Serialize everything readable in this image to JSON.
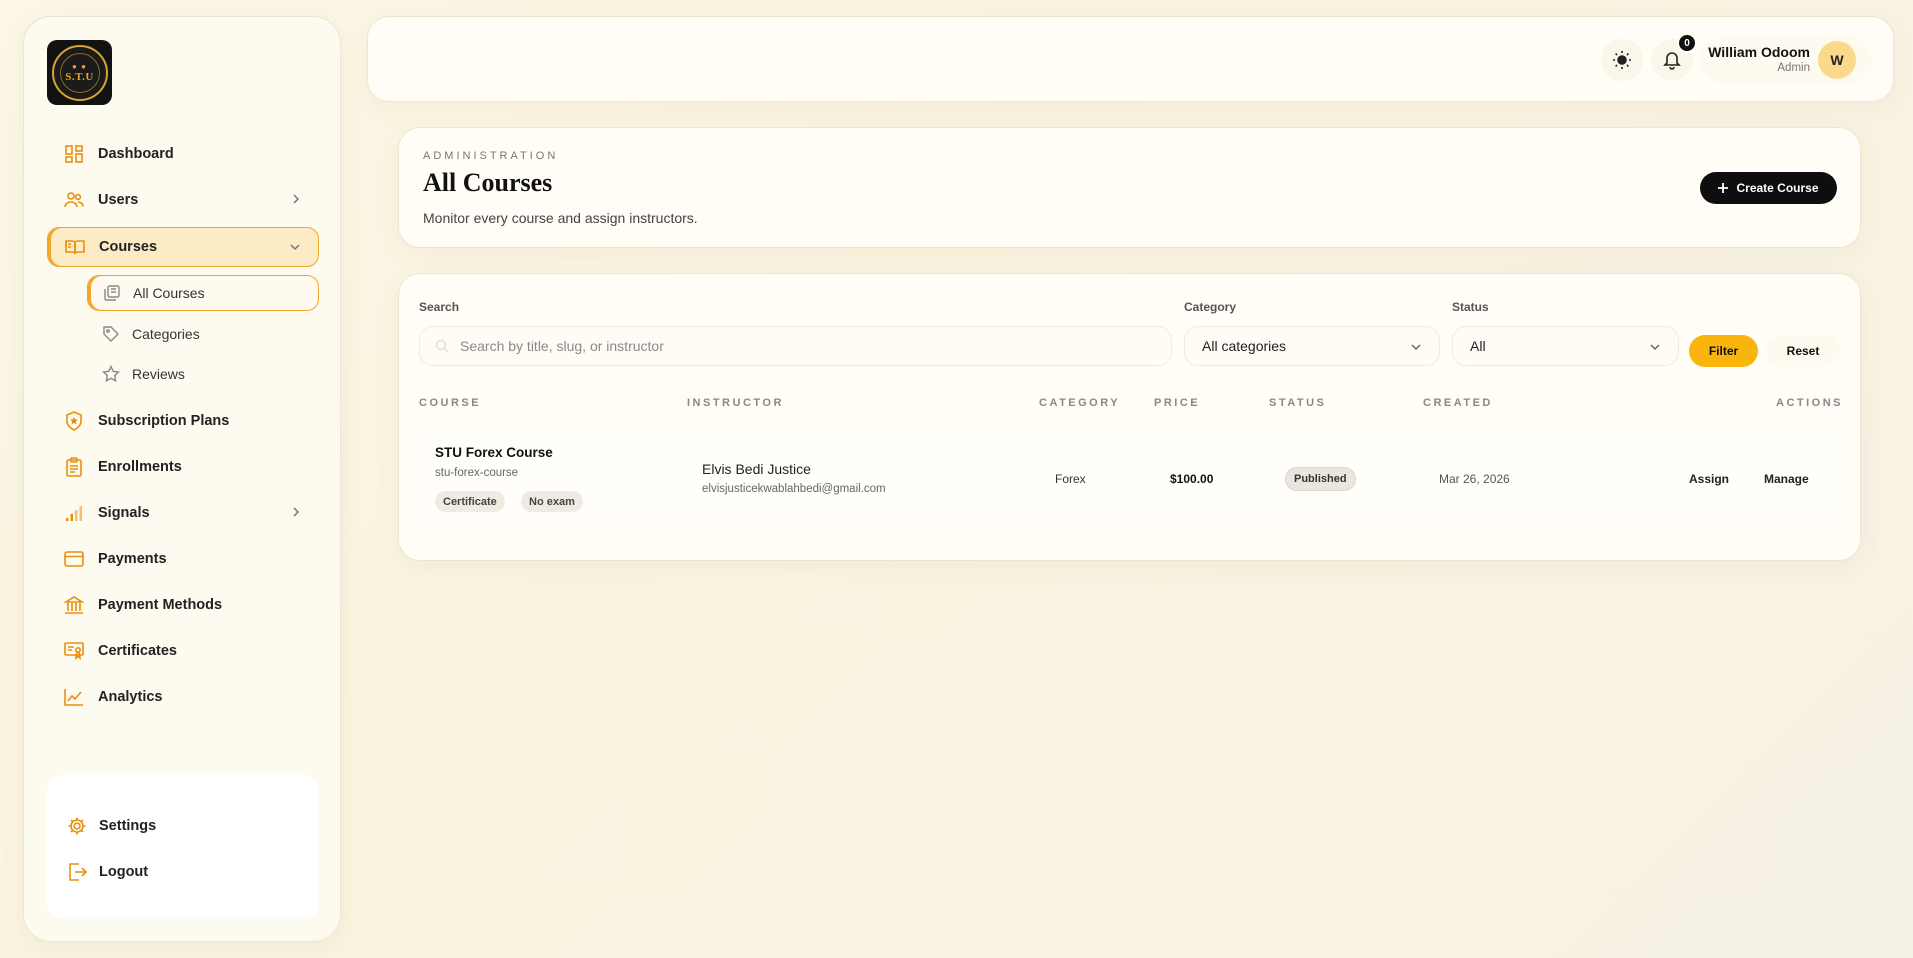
{
  "brand": {
    "logo_text": "S.T.U",
    "logo_ring_text": "SERENDIPITY TRADING UNIVERSITY"
  },
  "sidebar": {
    "items": [
      {
        "label": "Dashboard",
        "icon": "dashboard-icon"
      },
      {
        "label": "Users",
        "icon": "users-icon"
      },
      {
        "label": "Courses",
        "icon": "book-icon"
      },
      {
        "label": "Subscription Plans",
        "icon": "shield-star-icon"
      },
      {
        "label": "Enrollments",
        "icon": "clipboard-icon"
      },
      {
        "label": "Signals",
        "icon": "signal-bars-icon"
      },
      {
        "label": "Payments",
        "icon": "credit-card-icon"
      },
      {
        "label": "Payment Methods",
        "icon": "bank-icon"
      },
      {
        "label": "Certificates",
        "icon": "certificate-icon"
      },
      {
        "label": "Analytics",
        "icon": "chart-line-icon"
      }
    ],
    "sub_items": [
      {
        "label": "All Courses",
        "icon": "copy-icon"
      },
      {
        "label": "Categories",
        "icon": "tag-icon"
      },
      {
        "label": "Reviews",
        "icon": "star-icon"
      }
    ],
    "bottom": [
      {
        "label": "Settings",
        "icon": "gear-icon"
      },
      {
        "label": "Logout",
        "icon": "logout-icon"
      }
    ]
  },
  "topbar": {
    "notification_count": "0",
    "user_name": "William Odoom",
    "user_role": "Admin",
    "avatar_initial": "W"
  },
  "header": {
    "eyebrow": "ADMINISTRATION",
    "title": "All Courses",
    "subtitle": "Monitor every course and assign instructors.",
    "create_label": "Create Course"
  },
  "filters": {
    "search_label": "Search",
    "search_placeholder": "Search by title, slug, or instructor",
    "category_label": "Category",
    "category_value": "All categories",
    "status_label": "Status",
    "status_value": "All",
    "filter_label": "Filter",
    "reset_label": "Reset"
  },
  "table": {
    "headers": [
      "COURSE",
      "INSTRUCTOR",
      "CATEGORY",
      "PRICE",
      "STATUS",
      "CREATED",
      "ACTIONS"
    ],
    "rows": [
      {
        "title": "STU Forex Course",
        "slug": "stu-forex-course",
        "chips": [
          "Certificate",
          "No exam"
        ],
        "instructor_name": "Elvis Bedi Justice",
        "instructor_email": "elvisjusticekwablahbedi@gmail.com",
        "category": "Forex",
        "price": "$100.00",
        "status": "Published",
        "created": "Mar 26, 2026",
        "actions": [
          "Assign",
          "Manage"
        ]
      }
    ]
  },
  "colors": {
    "accent": "#f0a82a",
    "filter_button": "#f9b40e",
    "primary_button": "#0e0e0e"
  }
}
